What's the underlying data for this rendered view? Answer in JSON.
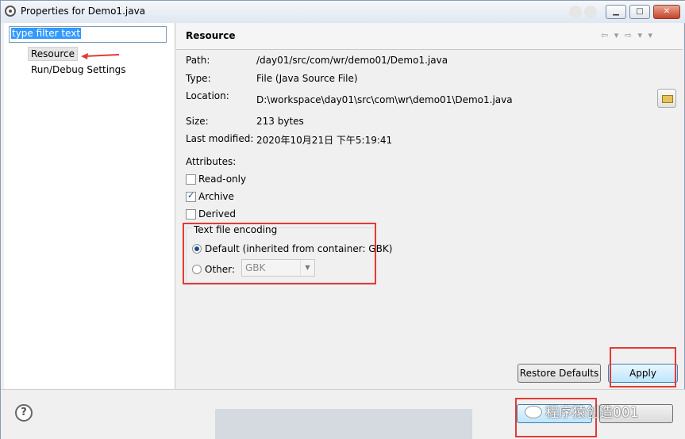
{
  "window": {
    "title": "Properties for Demo1.java"
  },
  "left_pane": {
    "filter_text": "type filter text",
    "items": [
      {
        "label": "Resource"
      },
      {
        "label": "Run/Debug Settings"
      }
    ]
  },
  "right_pane": {
    "title": "Resource",
    "path_label": "Path:",
    "path_value": "/day01/src/com/wr/demo01/Demo1.java",
    "type_label": "Type:",
    "type_value": "File  (Java Source File)",
    "location_label": "Location:",
    "location_value": "D:\\workspace\\day01\\src\\com\\wr\\demo01\\Demo1.java",
    "size_label": "Size:",
    "size_value": "213  bytes",
    "modified_label": "Last modified:",
    "modified_value": "2020年10月21日 下午5:19:41",
    "attributes_label": "Attributes:",
    "attributes": [
      {
        "label": "Read-only",
        "checked": false
      },
      {
        "label": "Archive",
        "checked": true
      },
      {
        "label": "Derived",
        "checked": false
      }
    ],
    "encoding": {
      "group_label": "Text file encoding",
      "default_label": "Default (inherited from container: GBK)",
      "other_label": "Other:",
      "other_value": "GBK",
      "selected": "default"
    },
    "restore_defaults_label": "Restore Defaults",
    "apply_label": "Apply"
  },
  "bottom": {
    "help_glyph": "?",
    "watermark": "程序猿创造001"
  }
}
